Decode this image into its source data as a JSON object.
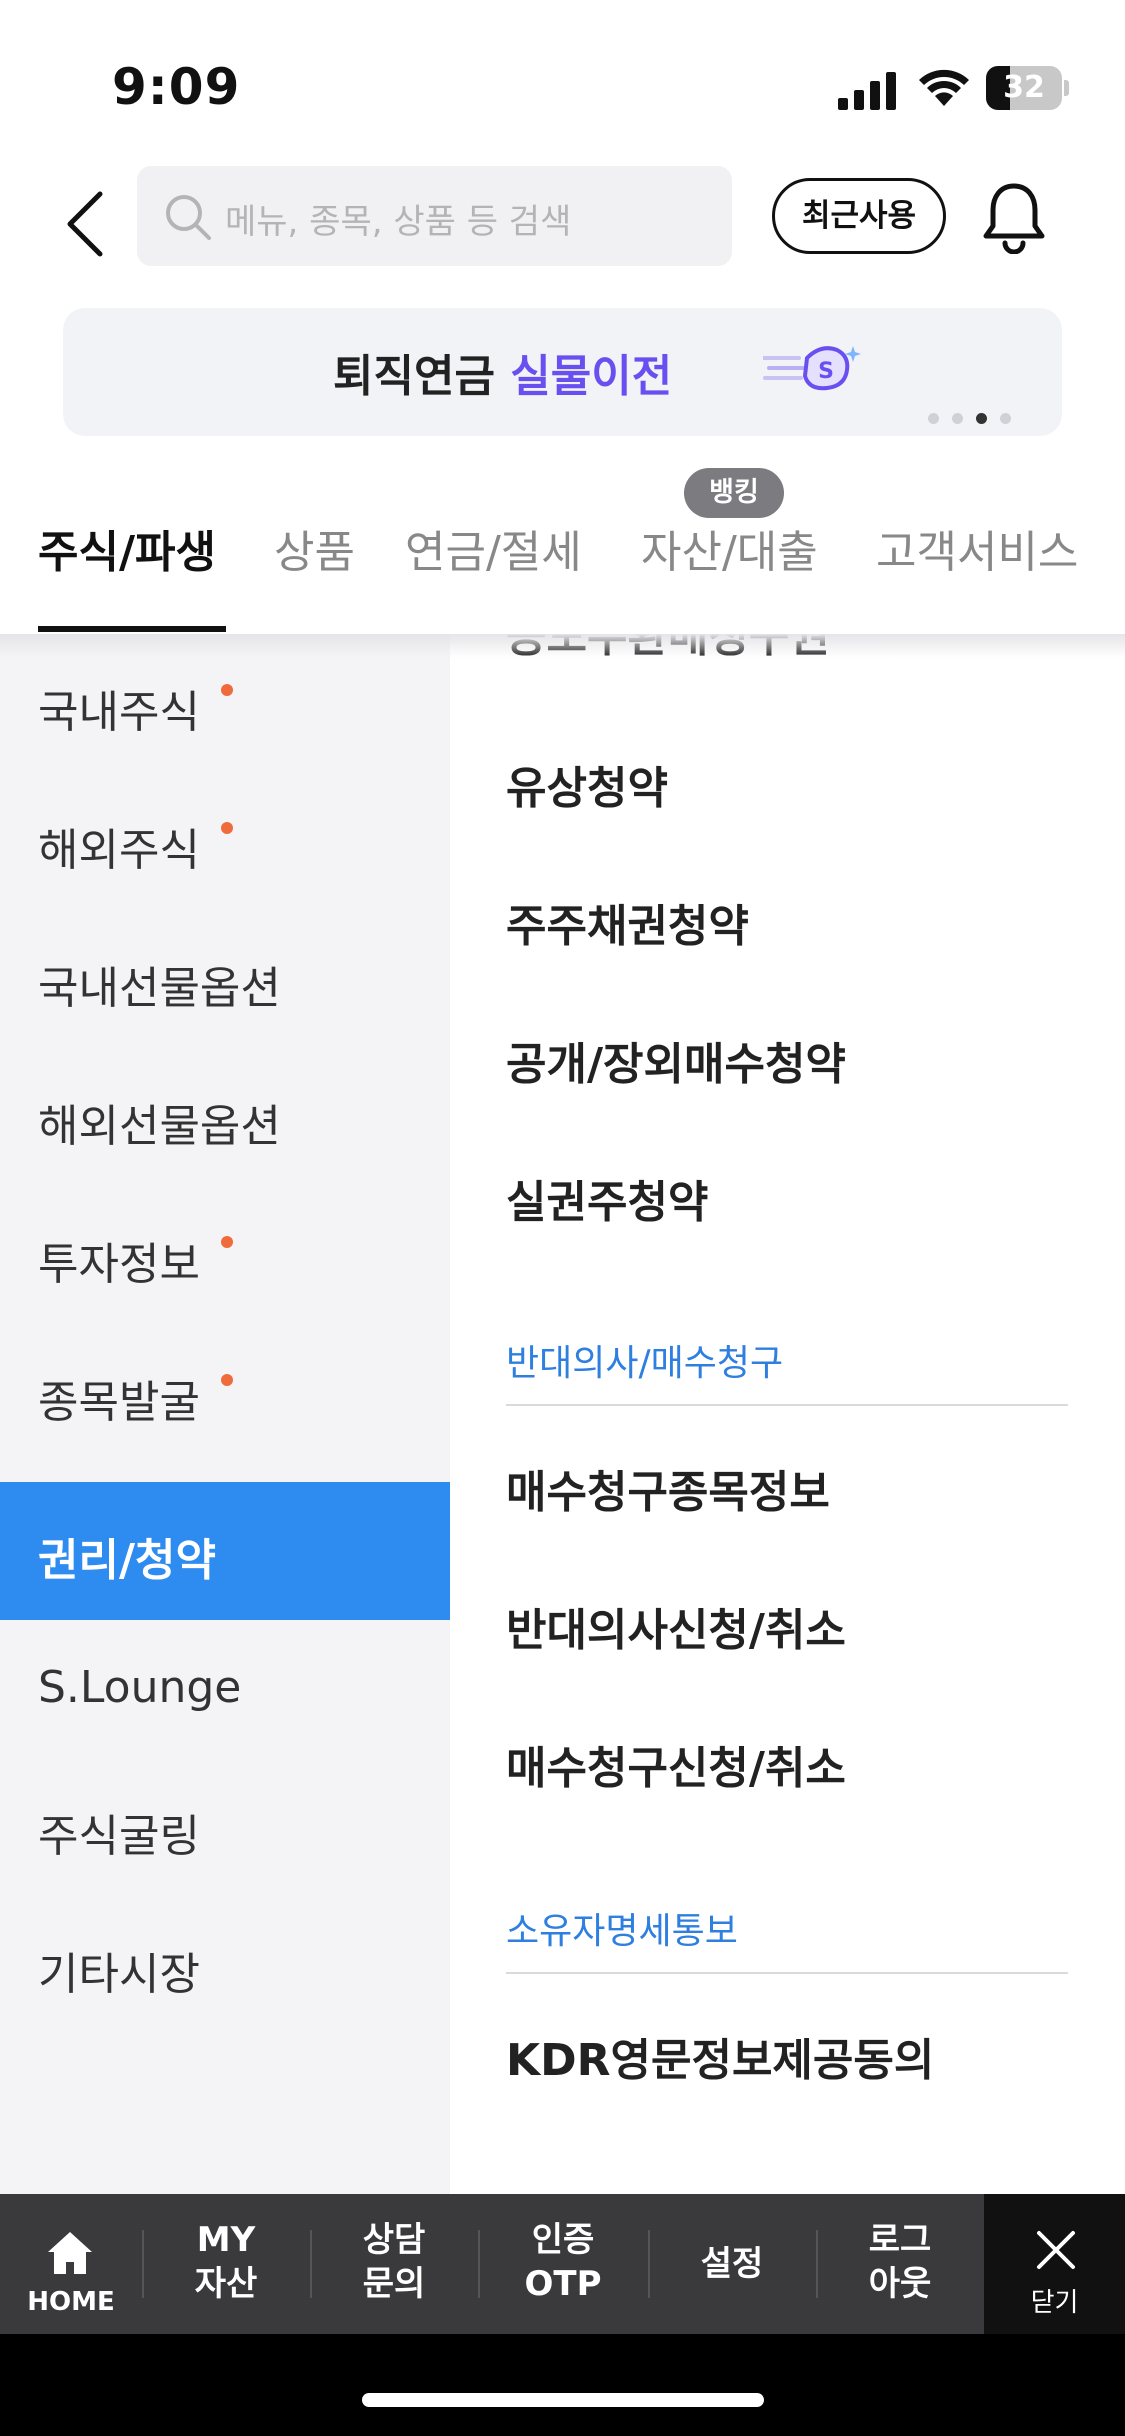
{
  "status_bar": {
    "time": "9:09",
    "battery": "32",
    "battery_level": 0.32
  },
  "header": {
    "search_placeholder": "메뉴, 종목, 상품 등 검색",
    "recent_label": "최근사용"
  },
  "banner": {
    "text_dark": "퇴직연금 ",
    "text_accent": "실물이전",
    "page_count": 4,
    "active_page": 3
  },
  "tabs": [
    {
      "label": "주식/파생",
      "active": true
    },
    {
      "label": "상품",
      "active": false
    },
    {
      "label": "연금/절세",
      "active": false
    },
    {
      "label": "자산/대출",
      "active": false,
      "badge": "뱅킹"
    },
    {
      "label": "고객서비스",
      "active": false
    }
  ],
  "sidebar": {
    "items": [
      {
        "label": "국내주식",
        "new": true
      },
      {
        "label": "해외주식",
        "new": true
      },
      {
        "label": "국내선물옵션",
        "new": false
      },
      {
        "label": "해외선물옵션",
        "new": false
      },
      {
        "label": "투자정보",
        "new": true
      },
      {
        "label": "종목발굴",
        "new": true
      },
      {
        "label": "권리/청약",
        "new": false,
        "active": true
      },
      {
        "label": "S.Lounge",
        "new": false
      },
      {
        "label": "주식굴링",
        "new": false
      },
      {
        "label": "기타시장",
        "new": false
      }
    ]
  },
  "content": {
    "partial_item": "공모주환매청구권",
    "items_top": [
      "유상청약",
      "주주채권청약",
      "공개/장외매수청약",
      "실권주청약"
    ],
    "section1_title": "반대의사/매수청구",
    "section1_items": [
      "매수청구종목정보",
      "반대의사신청/취소",
      "매수청구신청/취소"
    ],
    "section2_title": "소유자명세통보",
    "section2_items": [
      "KDR영문정보제공동의"
    ]
  },
  "bottom_bar": {
    "home_label": "HOME",
    "my_assets": [
      "MY",
      "자산"
    ],
    "consult": [
      "상담",
      "문의"
    ],
    "otp": [
      "인증",
      "OTP"
    ],
    "settings": "설정",
    "logout": [
      "로그",
      "아웃"
    ],
    "close_label": "닫기"
  },
  "colors": {
    "accent_blue": "#2e8bef",
    "section_blue": "#2e7fe0",
    "banner_purple": "#6a4ff0",
    "new_dot": "#f06b3c",
    "bottom_bar": "#3a3a3c"
  }
}
